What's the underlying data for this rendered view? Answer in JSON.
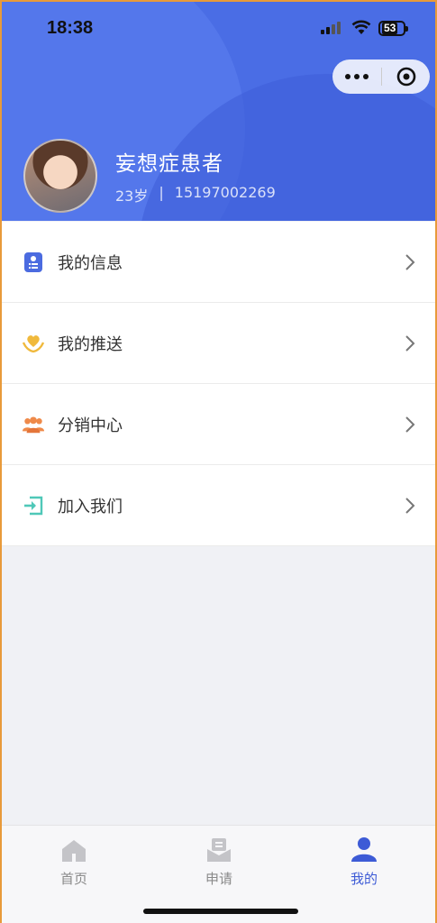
{
  "status_bar": {
    "time": "18:38",
    "battery": "53"
  },
  "profile": {
    "name": "妄想症患者",
    "age": "23岁",
    "separator": "|",
    "phone": "15197002269"
  },
  "menu": {
    "items": [
      {
        "label": "我的信息",
        "icon": "id-card-icon",
        "color": "#4b6be0"
      },
      {
        "label": "我的推送",
        "icon": "heart-hands-icon",
        "color": "#f0b93c"
      },
      {
        "label": "分销中心",
        "icon": "group-icon",
        "color": "#ef8a4a"
      },
      {
        "label": "加入我们",
        "icon": "enter-icon",
        "color": "#4fc8b8"
      }
    ]
  },
  "tabbar": {
    "tabs": [
      {
        "label": "首页",
        "icon": "home-icon",
        "active": false
      },
      {
        "label": "申请",
        "icon": "mail-icon",
        "active": false
      },
      {
        "label": "我的",
        "icon": "user-icon",
        "active": true
      }
    ]
  },
  "colors": {
    "header": "#4a6de5",
    "accent": "#3d5bd6",
    "background": "#f0f1f5"
  }
}
